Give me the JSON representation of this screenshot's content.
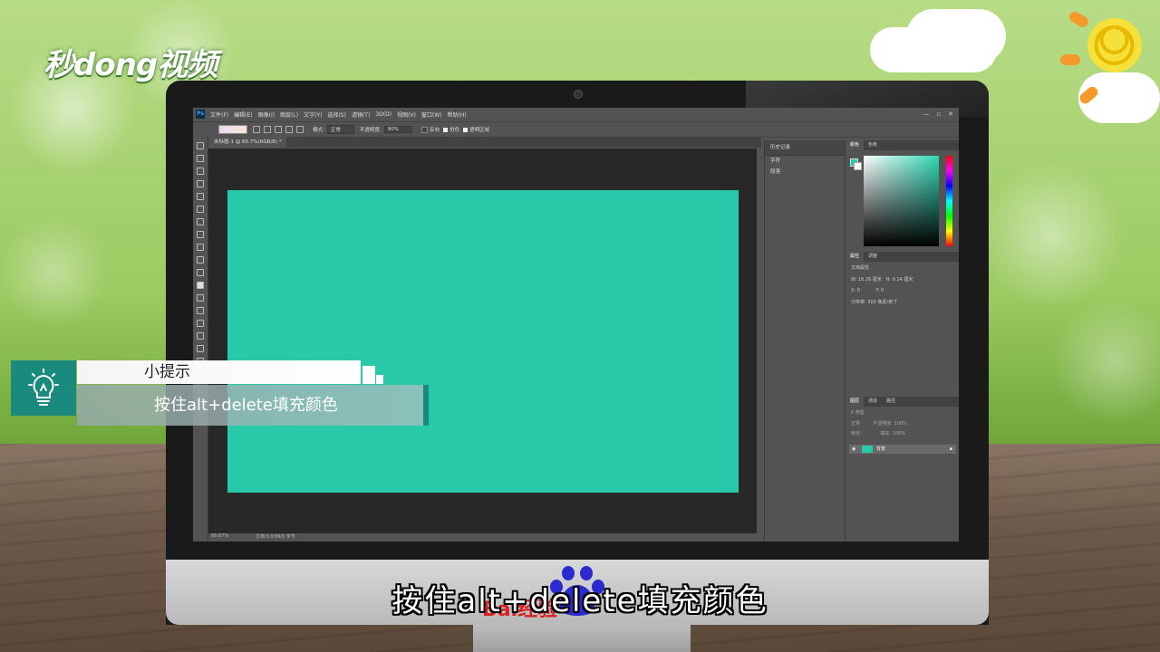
{
  "brand": {
    "logo_text": "秒dong视频"
  },
  "app": {
    "ps_logo": "Ps",
    "menu": [
      "文件(F)",
      "编辑(E)",
      "图像(I)",
      "图层(L)",
      "文字(Y)",
      "选择(S)",
      "滤镜(T)",
      "3D(D)",
      "视图(V)",
      "窗口(W)",
      "帮助(H)"
    ],
    "window_controls": [
      "—",
      "▫",
      "✕"
    ],
    "options": {
      "mode_label": "模式:",
      "mode_value": "正常",
      "opacity_label": "不透明度:",
      "opacity_value": "90%",
      "reverse_label": "反向",
      "dither_label": "仿色",
      "transparency_label": "透明区域"
    },
    "doc_tab": "未标题-1 @ 66.7%(RGB/8) *",
    "canvas_color": "#28c9a9",
    "status": {
      "zoom": "66.67%",
      "doc_size": "文档:5.93M/0 字节"
    },
    "history_panel": {
      "tab": "历史记录",
      "items": [
        "字符",
        "段落"
      ]
    },
    "color_panel": {
      "tabs": [
        "颜色",
        "色板"
      ]
    },
    "properties_panel": {
      "tabs": [
        "属性",
        "调整"
      ],
      "title": "文档属性",
      "w_label": "W: 16.26 厘米",
      "h_label": "H: 9.14 厘米",
      "x_label": "X: 0",
      "y_label": "Y: 0",
      "resolution": "分辨率: 300 像素/英寸"
    },
    "layers_panel": {
      "tabs": [
        "图层",
        "通道",
        "路径"
      ],
      "kind_placeholder": "P 类型",
      "blend": "正常",
      "opacity": "不透明度: 100%",
      "lock": "锁定:",
      "fill": "填充: 100%",
      "layer_name": "背景"
    }
  },
  "tip": {
    "title": "小提示",
    "body": "按住alt+delete填充颜色"
  },
  "subtitle": "按住alt+delete填充颜色",
  "watermark": {
    "text": "Bai经验"
  }
}
